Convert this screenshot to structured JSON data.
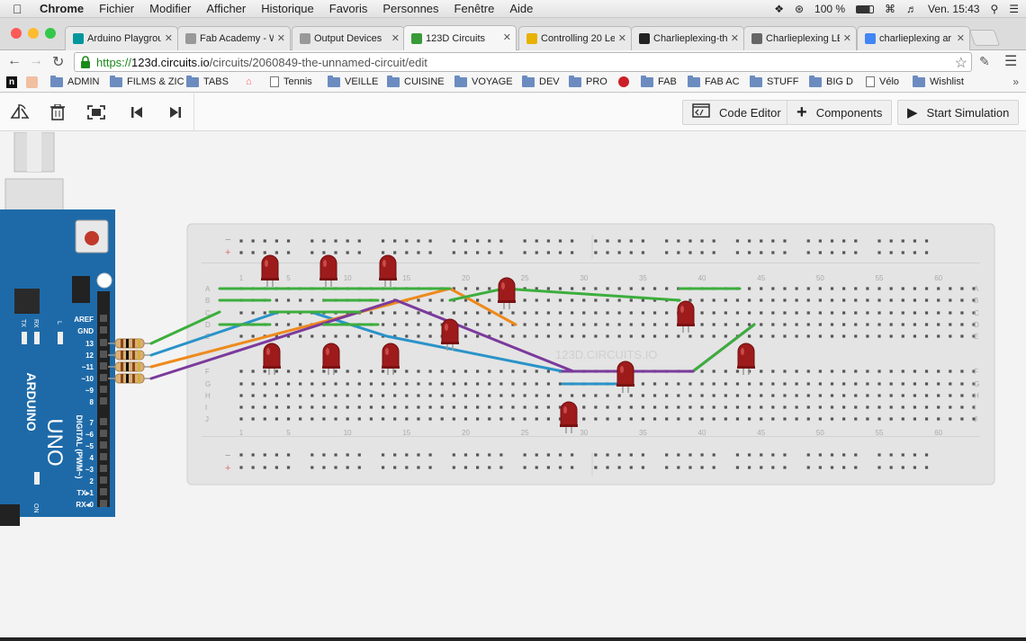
{
  "menubar": {
    "app": "Chrome",
    "items": [
      "Fichier",
      "Modifier",
      "Afficher",
      "Historique",
      "Favoris",
      "Personnes",
      "Fenêtre",
      "Aide"
    ],
    "battery": "100 %",
    "clock": "Ven. 15:43"
  },
  "tabs": [
    {
      "label": "Arduino Playgrou",
      "icon": "arduino-icon",
      "color": "#00979c"
    },
    {
      "label": "Fab Academy - W",
      "icon": "page-icon",
      "color": "#999999"
    },
    {
      "label": "Output Devices",
      "icon": "page-icon",
      "color": "#999999"
    },
    {
      "label": "123D Circuits",
      "icon": "circuits-icon",
      "color": "#3a9a3a",
      "active": true
    },
    {
      "label": "Controlling 20 Le",
      "icon": "instructables-icon",
      "color": "#e8b200"
    },
    {
      "label": "Charlieplexing-th",
      "icon": "github-icon",
      "color": "#222222"
    },
    {
      "label": "Charlieplexing LE",
      "icon": "wave-icon",
      "color": "#666666"
    },
    {
      "label": "charlieplexing ar",
      "icon": "google-icon",
      "color": "#4285f4"
    }
  ],
  "address": {
    "scheme": "https://",
    "host": "123d.circuits.io",
    "path": "/circuits/2060849-the-unnamed-circuit/edit"
  },
  "bookmarks": [
    {
      "label": "",
      "icon": "n-icon"
    },
    {
      "label": "",
      "icon": "profile-icon"
    },
    {
      "label": "ADMIN",
      "icon": "folder-icon"
    },
    {
      "label": "FILMS & ZIC",
      "icon": "folder-icon"
    },
    {
      "label": "TABS",
      "icon": "folder-icon"
    },
    {
      "label": "",
      "icon": "airbnb-icon"
    },
    {
      "label": "Tennis",
      "icon": "doc-icon"
    },
    {
      "label": "VEILLE",
      "icon": "folder-icon"
    },
    {
      "label": "CUISINE",
      "icon": "folder-icon"
    },
    {
      "label": "VOYAGE",
      "icon": "folder-icon"
    },
    {
      "label": "DEV",
      "icon": "folder-icon"
    },
    {
      "label": "PRO",
      "icon": "folder-icon"
    },
    {
      "label": "",
      "icon": "pinterest-icon"
    },
    {
      "label": "FAB",
      "icon": "folder-icon"
    },
    {
      "label": "FAB AC",
      "icon": "folder-icon"
    },
    {
      "label": "STUFF",
      "icon": "folder-icon"
    },
    {
      "label": "BIG D",
      "icon": "folder-icon"
    },
    {
      "label": "Vélo",
      "icon": "doc-icon"
    },
    {
      "label": "Wishlist",
      "icon": "folder-icon"
    }
  ],
  "toolbar": {
    "code_editor": "Code Editor",
    "components": "Components",
    "start_simulation": "Start Simulation"
  },
  "board": {
    "name": "UNO",
    "brand": "ARDUINO",
    "header_labels": [
      "AREF",
      "GND",
      "13",
      "12",
      "~11",
      "~10",
      "~9",
      "8",
      "7",
      "~6",
      "~5",
      "4",
      "~3",
      "2",
      "TX▸1",
      "RX◂0"
    ],
    "silk_digital": "DIGITAL (PWM~)",
    "silk_on": "ON",
    "silk_tx": "TX",
    "silk_rx": "RX",
    "silk_l": "L"
  },
  "breadboard": {
    "watermark": "123D.CIRCUITS.IO",
    "col_numbers": [
      "1",
      "5",
      "10",
      "15",
      "20",
      "25",
      "30",
      "35",
      "40",
      "45",
      "50",
      "55",
      "60"
    ],
    "rows_top": [
      "A",
      "B",
      "C",
      "D",
      "E"
    ],
    "rows_bottom": [
      "F",
      "G",
      "H",
      "I",
      "J"
    ],
    "rail_minus": "−",
    "rail_plus": "+"
  },
  "colors": {
    "wire_green": "#3cae3c",
    "wire_blue": "#2a93c9",
    "wire_orange": "#ee8a1c",
    "wire_purple": "#7b3a9c",
    "led_red": "#9e1b1b",
    "arduino_blue": "#1e6aa8",
    "url_green": "#1a8a1a"
  }
}
